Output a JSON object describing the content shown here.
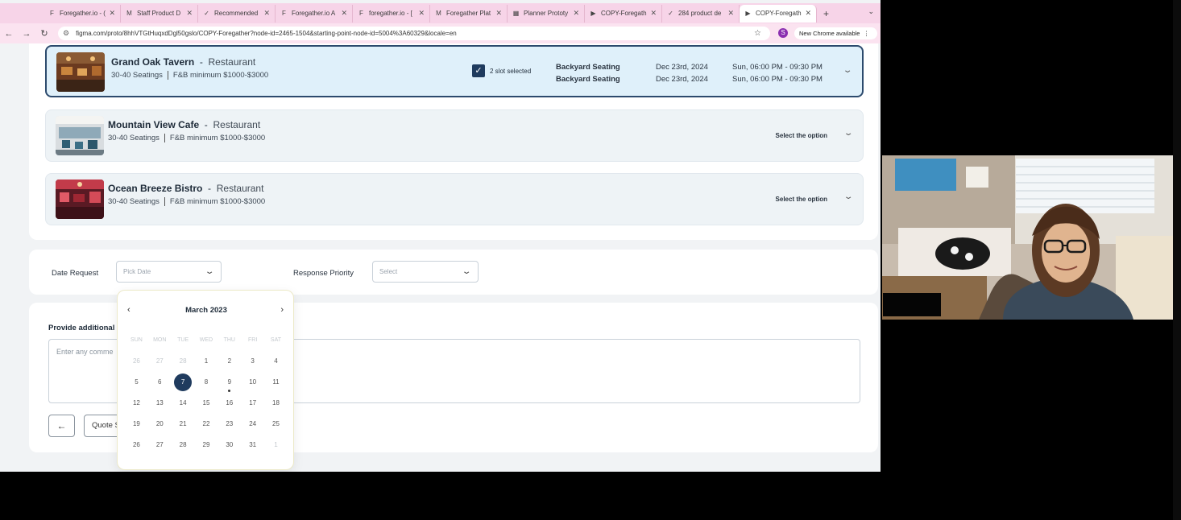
{
  "browser": {
    "tabs": [
      {
        "label": "Foregather.io - (",
        "favicon": "F"
      },
      {
        "label": "Staff Product D",
        "favicon": "M"
      },
      {
        "label": "Recommended",
        "favicon": "✓"
      },
      {
        "label": "Foregather.io A",
        "favicon": "F"
      },
      {
        "label": "foregather.io - [",
        "favicon": "F"
      },
      {
        "label": "Foregather Plat",
        "favicon": "M"
      },
      {
        "label": "Planner Prototy",
        "favicon": "▦"
      },
      {
        "label": "COPY-Foregath",
        "favicon": "▶"
      },
      {
        "label": "284 product de",
        "favicon": "✓"
      },
      {
        "label": "COPY-Foregath",
        "favicon": "▶"
      }
    ],
    "url": "figma.com/proto/8hhVTGtHuqxdDgl50gslo/COPY-Foregather?node-id=2465-1504&starting-point-node-id=5004%3A60329&locale=en",
    "profile_initial": "S",
    "update_label": "New Chrome available"
  },
  "venues": [
    {
      "name": "Grand Oak Tavern",
      "type": "Restaurant",
      "seatings": "30-40 Seatings",
      "fb_minimum": "F&B minimum $1000-$3000",
      "selected": true,
      "slot_label": "2 slot selected",
      "slots": [
        {
          "area": "Backyard Seating",
          "date": "Dec 23rd, 2024",
          "time": "Sun, 06:00 PM - 09:30 PM"
        },
        {
          "area": "Backyard Seating",
          "date": "Dec 23rd, 2024",
          "time": "Sun, 06:00 PM - 09:30 PM"
        }
      ]
    },
    {
      "name": "Mountain View Cafe",
      "type": "Restaurant",
      "seatings": "30-40 Seatings",
      "fb_minimum": "F&B minimum $1000-$3000",
      "select_label": "Select the option"
    },
    {
      "name": "Ocean Breeze Bistro",
      "type": "Restaurant",
      "seatings": "30-40 Seatings",
      "fb_minimum": "F&B minimum $1000-$3000",
      "select_label": "Select the option"
    }
  ],
  "form": {
    "date_label": "Date Request",
    "date_placeholder": "Pick Date",
    "priority_label": "Response Priority",
    "priority_placeholder": "Select",
    "comments_label": "Provide additional c",
    "comments_placeholder": "Enter any comme",
    "back_icon": "arrow-left-icon",
    "quote_label": "Quote S"
  },
  "calendar": {
    "month": "March 2023",
    "weekdays": [
      "SUN",
      "MON",
      "TUE",
      "WED",
      "THU",
      "FRI",
      "SAT"
    ],
    "weeks": [
      [
        "26",
        "27",
        "28",
        "1",
        "2",
        "3",
        "4"
      ],
      [
        "5",
        "6",
        "7",
        "8",
        "9",
        "10",
        "11"
      ],
      [
        "12",
        "13",
        "14",
        "15",
        "16",
        "17",
        "18"
      ],
      [
        "19",
        "20",
        "21",
        "22",
        "23",
        "24",
        "25"
      ],
      [
        "26",
        "27",
        "28",
        "29",
        "30",
        "31",
        "1"
      ]
    ],
    "selected_day": "7",
    "marked_day": "9"
  },
  "colors": {
    "accent": "#1f3b5e",
    "selected_card_bg": "#dff0fa",
    "tab_bar": "#f7d4e8"
  }
}
